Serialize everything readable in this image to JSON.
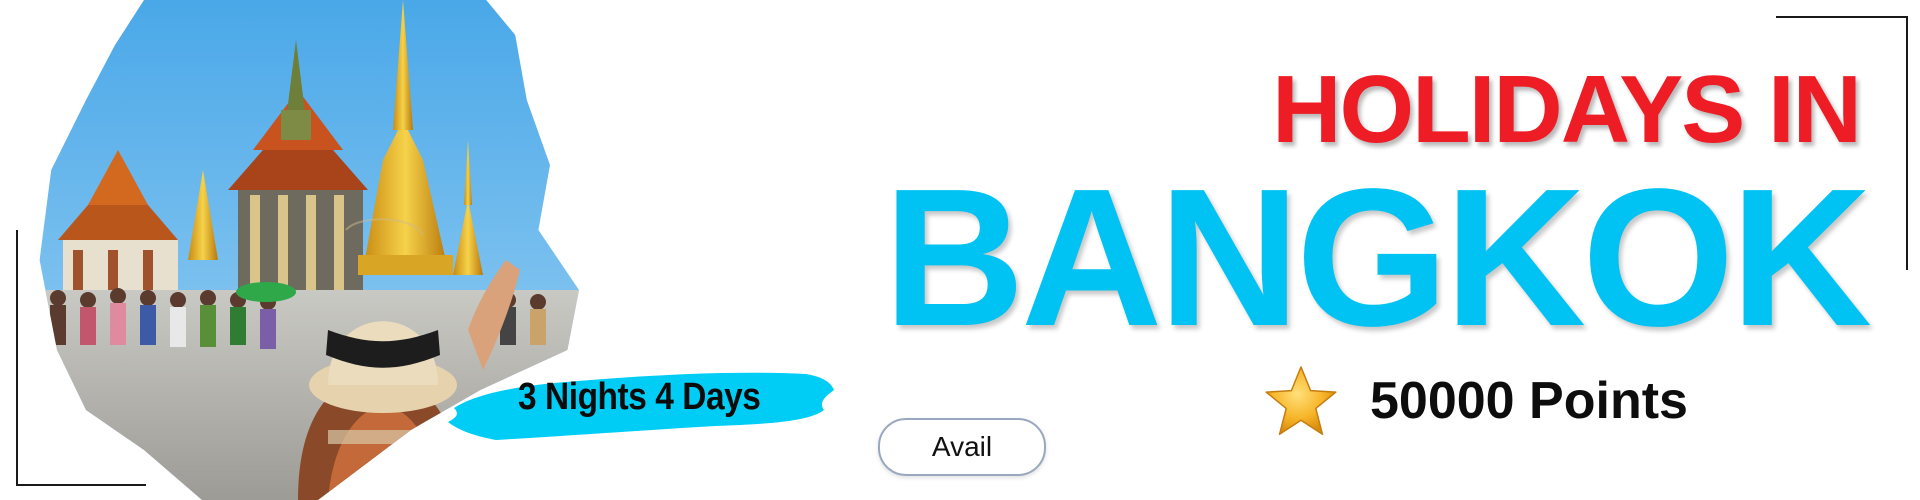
{
  "banner": {
    "headline": "HOLIDAYS IN",
    "destination": "BANGKOK",
    "duration": "3 Nights 4 Days",
    "points": "50000 Points",
    "cta_label": "Avail"
  },
  "colors": {
    "headline": "#ee1c24",
    "destination": "#00c3f3",
    "brush": "#00cdf5",
    "star": "#f7b52a"
  },
  "icons": {
    "points": "star-icon"
  }
}
